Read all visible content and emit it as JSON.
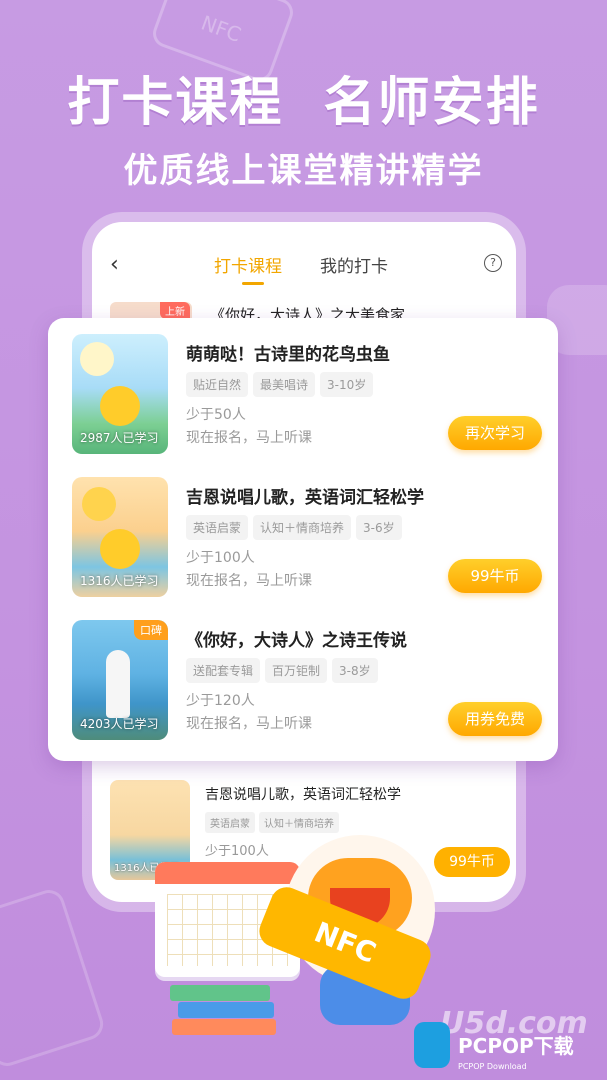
{
  "headline": {
    "main": "打卡课程  名师安排",
    "sub": "优质线上课堂精讲精学"
  },
  "decor": {
    "nfc_card_text": "NFC"
  },
  "phone": {
    "nav": {
      "back_icon": "chevron-left-icon",
      "back_glyph": "‹",
      "tabs": [
        {
          "label": "打卡课程",
          "active": true
        },
        {
          "label": "我的打卡",
          "active": false
        }
      ],
      "help_glyph": "?"
    },
    "peek": {
      "badge": "上新",
      "title": "《你好，大诗人》之大美食家"
    },
    "bottom_course": {
      "title": "吉恩说唱儿歌，英语词汇轻松学",
      "tags": [
        "英语启蒙",
        "认知＋情商培养"
      ],
      "fewer": "少于100人",
      "count": "1316人已学习",
      "price": "99牛币"
    }
  },
  "courses": [
    {
      "title": "萌萌哒！古诗里的花鸟虫鱼",
      "tags": [
        "贴近自然",
        "最美唱诗",
        "3-10岁"
      ],
      "fewer": "少于50人",
      "sub": "现在报名，马上听课",
      "count": "2987人已学习",
      "badge": "",
      "button": "再次学习"
    },
    {
      "title": "吉恩说唱儿歌，英语词汇轻松学",
      "tags": [
        "英语启蒙",
        "认知＋情商培养",
        "3-6岁"
      ],
      "fewer": "少于100人",
      "sub": "现在报名，马上听课",
      "count": "1316人已学习",
      "badge": "",
      "button": "99牛币"
    },
    {
      "title": "《你好，大诗人》之诗王传说",
      "tags": [
        "送配套专辑",
        "百万钜制",
        "3-8岁"
      ],
      "fewer": "少于120人",
      "sub": "现在报名，马上听课",
      "count": "4203人已学习",
      "badge": "口碑",
      "button": "用券免费"
    }
  ],
  "mascot": {
    "tag_text": "NFC"
  },
  "watermark": {
    "site": "U5d.com",
    "brand": "PCPOP下载",
    "sub": "PCPOP Download"
  },
  "colors": {
    "background": "#c493e0",
    "accent": "#ffa800",
    "tab_active": "#f2a600"
  }
}
